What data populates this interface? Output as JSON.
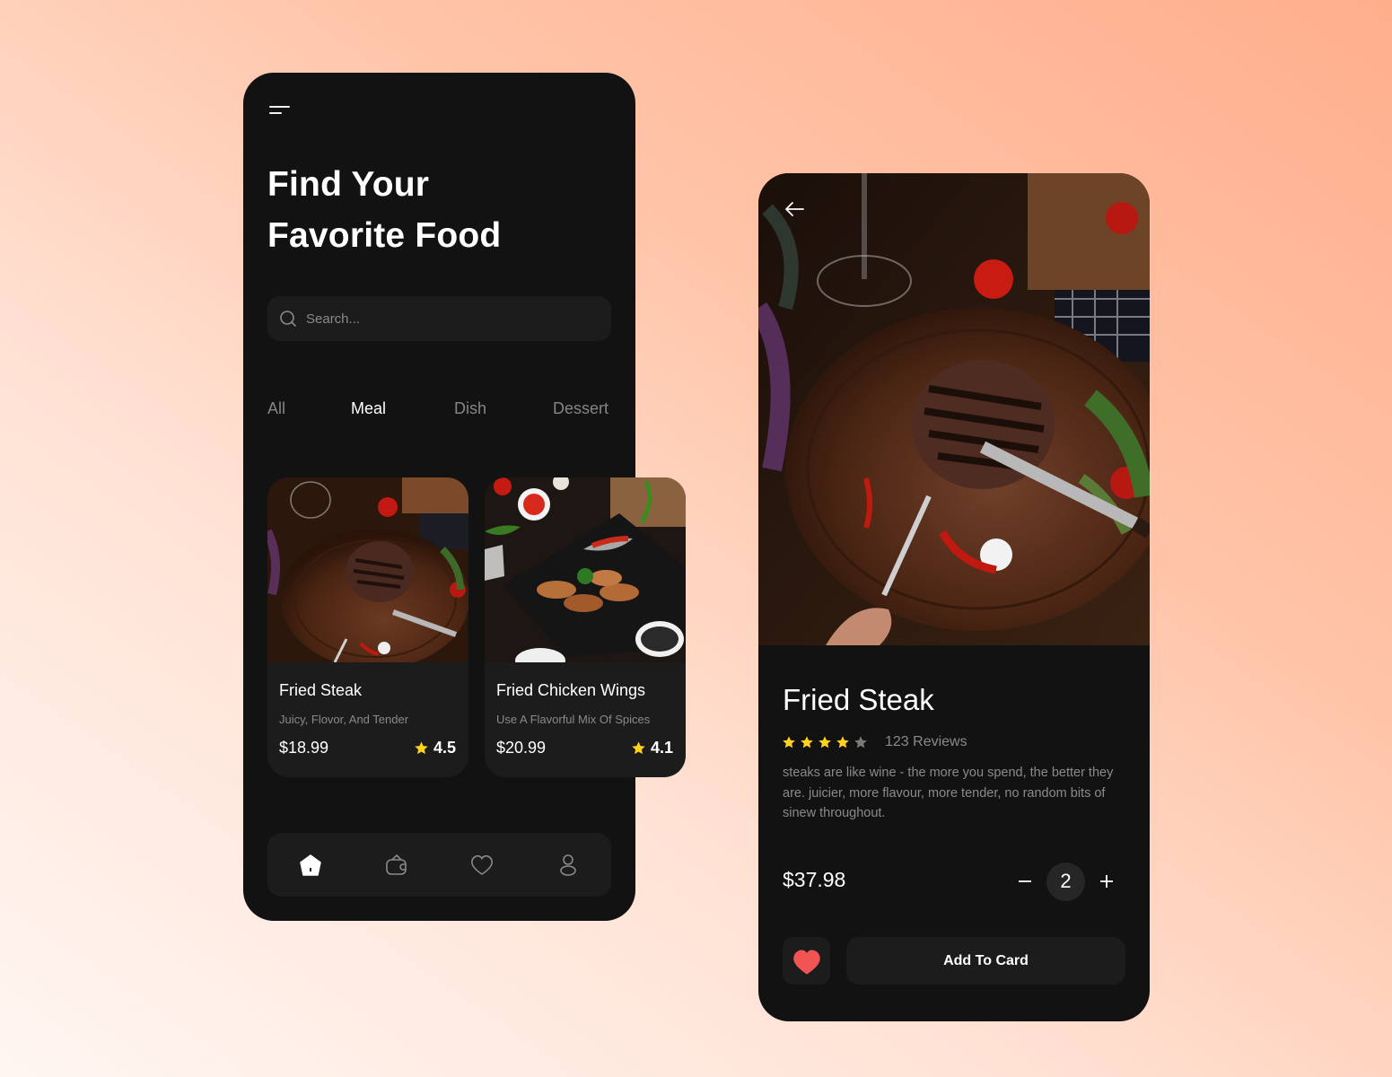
{
  "home": {
    "menu_icon": "menu-icon",
    "headline": {
      "line1": "Find Your",
      "line2": "Favorite Food"
    },
    "search": {
      "placeholder": "Search...",
      "value": "",
      "icon": "search-icon"
    },
    "tabs": [
      {
        "label": "All",
        "active": false
      },
      {
        "label": "Meal",
        "active": true
      },
      {
        "label": "Dish",
        "active": false
      },
      {
        "label": "Dessert",
        "active": false
      }
    ],
    "cards": [
      {
        "title": "Fried Steak",
        "subtitle": "Juicy, Flovor, And Tender",
        "price": "$18.99",
        "rating": "4.5",
        "image": "steak-photo"
      },
      {
        "title": "Fried Chicken Wings",
        "subtitle": "Use A Flavorful Mix Of Spices",
        "price": "$20.99",
        "rating": "4.1",
        "image": "chicken-wings-photo"
      }
    ],
    "bottom_nav": [
      {
        "icon": "home-icon",
        "active": true
      },
      {
        "icon": "wallet-icon",
        "active": false
      },
      {
        "icon": "heart-icon",
        "active": false
      },
      {
        "icon": "user-icon",
        "active": false
      }
    ]
  },
  "detail": {
    "back_icon": "arrow-left-icon",
    "title": "Fried Steak",
    "rating_stars": 4,
    "rating_max": 5,
    "reviews": "123 Reviews",
    "description": "steaks are like wine - the more you spend, the better they are. juicier, more flavour, more tender, no random bits of sinew throughout.",
    "price": "$37.98",
    "quantity": "2",
    "add_button": "Add To Card"
  },
  "colors": {
    "accent_star": "#ffd21f",
    "star_inactive": "#7a7a7a",
    "heart": "#f25454",
    "panel": "#121212",
    "surface": "#1c1c1c"
  }
}
